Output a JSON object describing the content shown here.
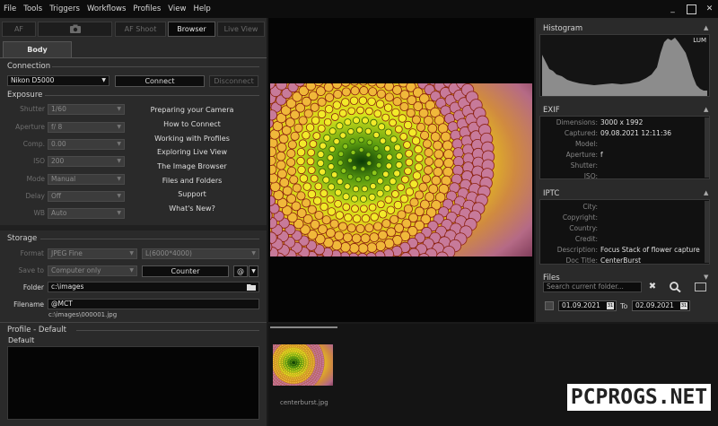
{
  "menu": [
    "File",
    "Tools",
    "Triggers",
    "Workflows",
    "Profiles",
    "View",
    "Help"
  ],
  "window": {
    "minimize": "_",
    "close": "✕"
  },
  "tabs": [
    {
      "label": "AF",
      "active": false
    },
    {
      "label": "",
      "icon": "camera-icon",
      "active": false
    },
    {
      "label": "AF Shoot",
      "active": false
    },
    {
      "label": "Browser",
      "active": true
    },
    {
      "label": "Live View",
      "active": false
    }
  ],
  "subtab": "Body",
  "connection": {
    "section": "Connection",
    "camera": "Nikon D5000",
    "connect": "Connect",
    "disconnect": "Disconnect"
  },
  "exposure": {
    "section": "Exposure",
    "rows": [
      {
        "label": "Shutter",
        "value": "1/60"
      },
      {
        "label": "Aperture",
        "value": "f/ 8"
      },
      {
        "label": "Comp.",
        "value": "0.00"
      },
      {
        "label": "ISO",
        "value": "200"
      },
      {
        "label": "Mode",
        "value": "Manual"
      },
      {
        "label": "Delay",
        "value": "Off"
      },
      {
        "label": "WB",
        "value": "Auto"
      }
    ]
  },
  "help_links": [
    "Preparing your Camera",
    "How to Connect",
    "Working with Profiles",
    "Exploring Live View",
    "The Image Browser",
    "Files and Folders",
    "Support",
    "What's New?"
  ],
  "storage": {
    "section": "Storage",
    "format_label": "Format",
    "format_value": "JPEG Fine",
    "size_value": "L(6000*4000)",
    "saveto_label": "Save to",
    "saveto_value": "Computer only",
    "counter": "Counter",
    "at": "@",
    "folder_label": "Folder",
    "folder_value": "c:\\images",
    "filename_label": "Filename",
    "filename_value": "@MCT",
    "filename_preview": "c:\\images\\000001.jpg"
  },
  "profile": {
    "section": "Profile - Default",
    "name": "Default"
  },
  "histogram": {
    "title": "Histogram",
    "channel": "LUM"
  },
  "exif": {
    "title": "EXIF",
    "rows": [
      {
        "k": "Dimensions:",
        "v": "3000 x 1992"
      },
      {
        "k": "Captured:",
        "v": "09.08.2021 12:11:36"
      },
      {
        "k": "Model:",
        "v": ""
      },
      {
        "k": "Aperture:",
        "v": "f"
      },
      {
        "k": "Shutter:",
        "v": ""
      },
      {
        "k": "ISO:",
        "v": ""
      }
    ]
  },
  "iptc": {
    "title": "IPTC",
    "rows": [
      {
        "k": "City:",
        "v": ""
      },
      {
        "k": "Copyright:",
        "v": ""
      },
      {
        "k": "Country:",
        "v": ""
      },
      {
        "k": "Credit:",
        "v": ""
      },
      {
        "k": "Description:",
        "v": "Focus Stack of flower capture"
      },
      {
        "k": "Doc Title:",
        "v": "CenterBurst"
      }
    ]
  },
  "files": {
    "title": "Files",
    "search_placeholder": "Search current folder...",
    "date_from": "01.09.2021",
    "to_label": "To",
    "date_to": "02.09.2021",
    "cal": "31"
  },
  "thumbnail": {
    "filename": "centerburst.jpg"
  },
  "watermark": "PCPROGS.NET"
}
